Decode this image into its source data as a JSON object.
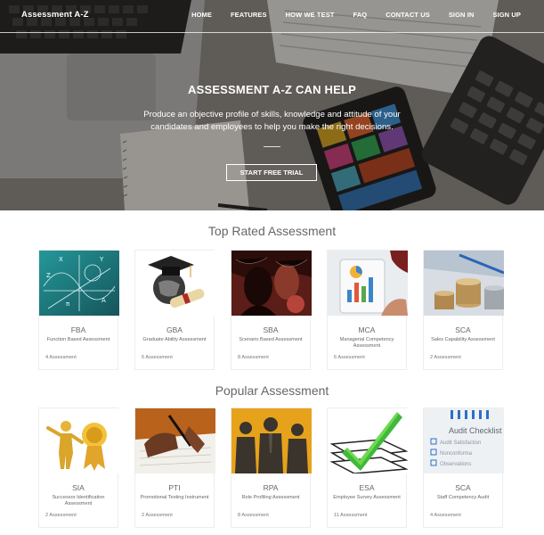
{
  "nav": {
    "brand": "Assessment A-Z",
    "links": [
      "HOME",
      "FEATURES",
      "HOW WE TEST",
      "FAQ",
      "CONTACT US",
      "SIGN IN",
      "SIGN UP"
    ]
  },
  "hero": {
    "title": "ASSESSMENT A-Z CAN HELP",
    "subtitle": "Produce an objective profile of skills, knowledge and attitude of your candidates and employees to help you make the right decisions.",
    "cta": "START FREE TRIAL"
  },
  "top_rated": {
    "title": "Top Rated Assessment",
    "cards": [
      {
        "abbr": "FBA",
        "full": "Function Based Assessment",
        "count": "4 Assessment",
        "icon": "math-chalkboard-image"
      },
      {
        "abbr": "GBA",
        "full": "Graduate Ability Assessment",
        "count": "6 Assessment",
        "icon": "graduation-cap-globe-image"
      },
      {
        "abbr": "SBA",
        "full": "Scenario Based Assessment",
        "count": "8 Assessment",
        "icon": "silhouette-scenario-image"
      },
      {
        "abbr": "MCA",
        "full": "Managerial Competency Assessment",
        "count": "6 Assessment",
        "icon": "tablet-chart-image"
      },
      {
        "abbr": "SCA",
        "full": "Sales Capability Assessment",
        "count": "2 Assessment",
        "icon": "coin-stacks-image"
      }
    ]
  },
  "popular": {
    "title": "Popular Assessment",
    "cards": [
      {
        "abbr": "SIA",
        "full": "Successor Identification Assessment",
        "count": "2 Assessment",
        "icon": "gold-figure-award-image"
      },
      {
        "abbr": "PTI",
        "full": "Promotional Testing Instrument",
        "count": "2 Assessment",
        "icon": "signing-document-image"
      },
      {
        "abbr": "RPA",
        "full": "Role Profiling Assessment",
        "count": "8 Assessment",
        "icon": "business-people-image"
      },
      {
        "abbr": "ESA",
        "full": "Employee Survey Assessment",
        "count": "11 Assessment",
        "icon": "green-checkmark-image"
      },
      {
        "abbr": "SCA",
        "full": "Staff Competency Audit",
        "count": "4 Assessment",
        "icon": "audit-checklist-image"
      }
    ]
  }
}
